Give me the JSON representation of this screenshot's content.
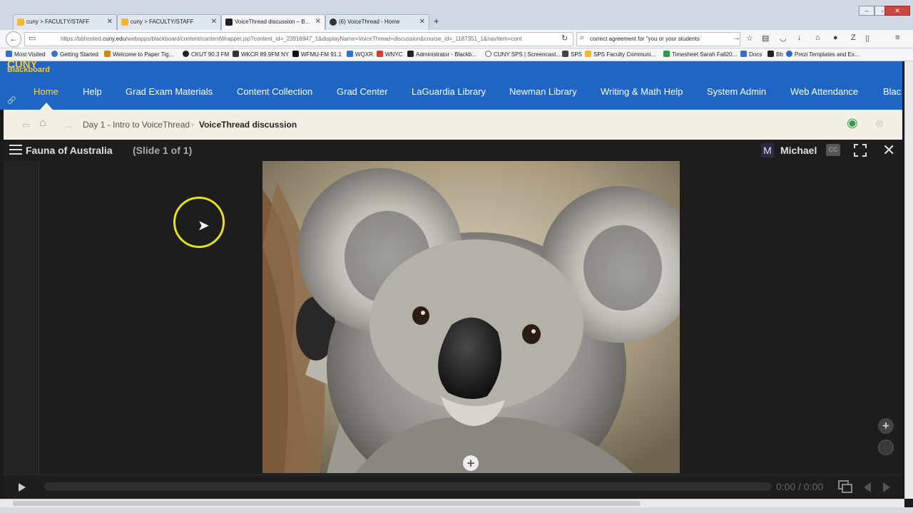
{
  "browser": {
    "tabs": [
      {
        "label": "cuny > FACULTY/STAFF",
        "active": false,
        "favicon_color": "#f2b632"
      },
      {
        "label": "cuny > FACULTY/STAFF",
        "active": false,
        "favicon_color": "#f2b632"
      },
      {
        "label": "VoiceThread discussion – B...",
        "active": true,
        "favicon_color": "#222222"
      },
      {
        "label": "(6) VoiceThread - Home",
        "active": false,
        "favicon_color": "#333333"
      }
    ],
    "url_prefix": "https://bbhosted.",
    "url_domain": "cuny.edu",
    "url_rest": "/webapps/blackboard/content/contentWrapper.jsp?content_id=_23916947_1&displayName=VoiceThread+discussion&course_id=_1187351_1&navItem=cont",
    "search_value": "correct agreement for \"you or your students",
    "bookmarks": [
      "Most Visited",
      "Getting Started",
      "Welcome to Paper Tig...",
      "CKUT 90.3 FM",
      "WKCR 89.9FM NY",
      "WFMU-FM 91.1",
      "WQXR",
      "WNYC",
      "Administrator - Blackb...",
      "CUNY SPS | Screencast...",
      "SPS",
      "SPS Faculty Communi...",
      "Timesheet Sarah Fall20...",
      "Docs",
      "Bb",
      "Prezi Templates and Ex..."
    ]
  },
  "blackboard": {
    "logo_top": "CUNY",
    "logo_bottom": "Blackboard",
    "nav": [
      "Home",
      "Help",
      "Grad Exam Materials",
      "Content Collection",
      "Grad Center",
      "LaGuardia Library",
      "Newman Library",
      "Writing & Math Help",
      "System Admin",
      "Web Attendance",
      "Blac"
    ],
    "active_nav": "Home",
    "breadcrumb": {
      "ellipsis": "...",
      "parent": "Day 1 - Intro to VoiceThread",
      "current": "VoiceThread discussion"
    }
  },
  "voicethread": {
    "title": "Fauna of Australia",
    "slide_info": "(Slide 1 of 1)",
    "user_initial": "M",
    "user_name": "Michael",
    "cc_label": "CC",
    "time": "0:00 / 0:00",
    "add_comment_symbol": "+"
  },
  "colors": {
    "bb_blue": "#1f66c4",
    "bb_gold": "#f4c842",
    "cursor_highlight": "#e6e21a"
  }
}
